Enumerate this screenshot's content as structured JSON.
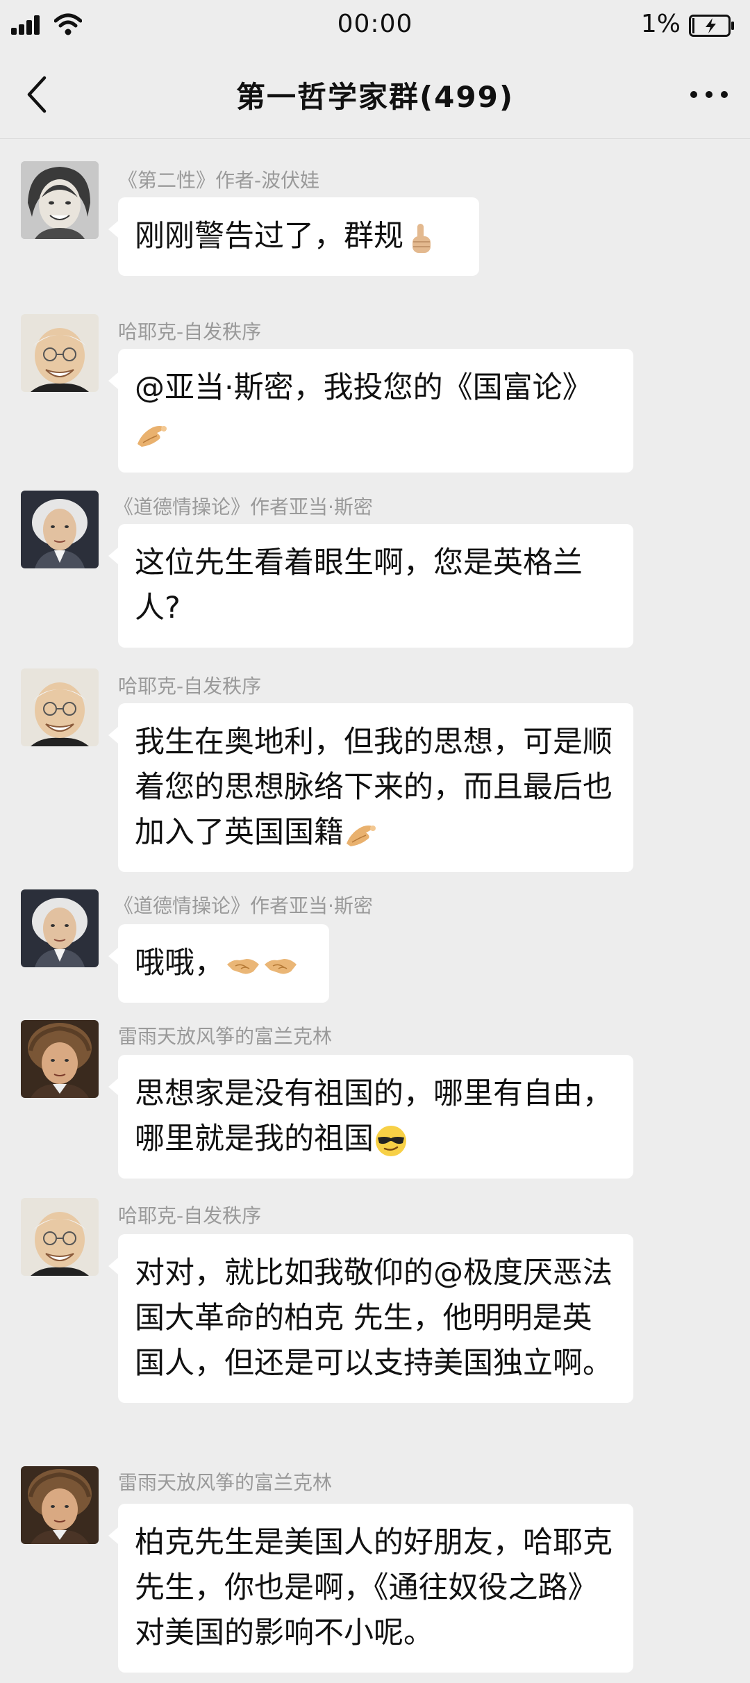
{
  "status": {
    "time": "00:00",
    "battery": "1%"
  },
  "nav": {
    "title": "第一哲学家群(499)"
  },
  "messages": [
    {
      "sender": "《第二性》作者-波伏娃",
      "text": "刚刚警告过了，群规",
      "emoji": "pointing-up-icon"
    },
    {
      "sender": "哈耶克-自发秩序",
      "text": "@亚当·斯密，我投您的《国富论》",
      "emoji": "pinched-fingers-icon"
    },
    {
      "sender": "《道德情操论》作者亚当·斯密",
      "text": "这位先生看着眼生啊，您是英格兰人?"
    },
    {
      "sender": "哈耶克-自发秩序",
      "text": "我生在奥地利，但我的思想，可是顺着您的思想脉络下来的，而且最后也加入了英国国籍",
      "emoji": "pinched-fingers-icon"
    },
    {
      "sender": "《道德情操论》作者亚当·斯密",
      "text": "哦哦，",
      "emoji": "handshake-icon"
    },
    {
      "sender": "雷雨天放风筝的富兰克林",
      "text": "思想家是没有祖国的，哪里有自由，哪里就是我的祖国",
      "emoji": "sunglasses-face-icon"
    },
    {
      "sender": "哈耶克-自发秩序",
      "text": "对对，就比如我敬仰的@极度厌恶法国大革命的柏克 先生，他明明是英国人，但还是可以支持美国独立啊。"
    },
    {
      "sender": "雷雨天放风筝的富兰克林",
      "text": "柏克先生是美国人的好朋友，哈耶克先生，你也是啊，《通往奴役之路》对美国的影响不小呢。"
    }
  ]
}
